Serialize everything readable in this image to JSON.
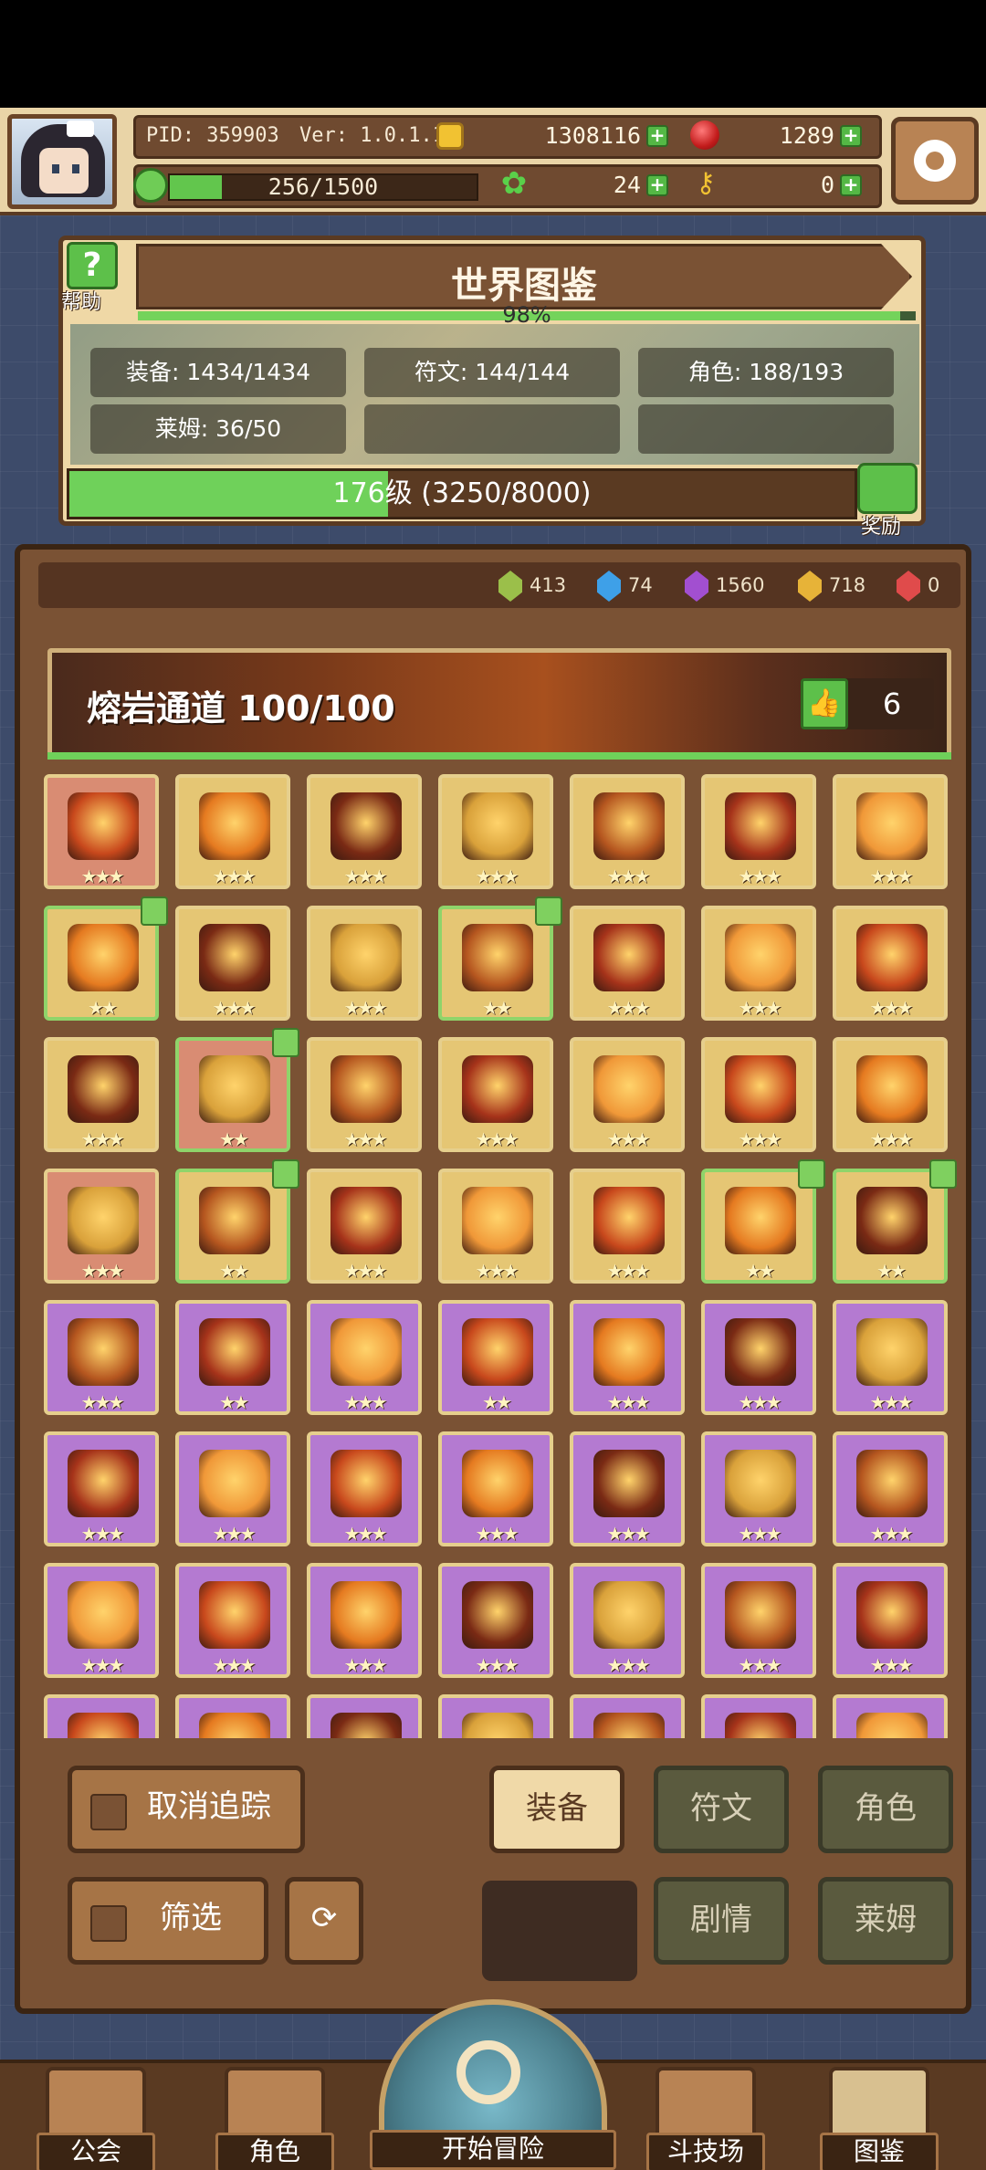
{
  "header": {
    "pid": "PID: 359903",
    "version": "Ver: 1.0.1.13",
    "gold": "1308116",
    "ruby": "1289",
    "stamina": "256/1500",
    "stamina_fraction": 0.17,
    "clover": "24",
    "key": "0"
  },
  "world": {
    "title": "世界图鉴",
    "help_label": "帮助",
    "percent": "98%",
    "percent_value": 0.98,
    "stats": [
      "装备: 1434/1434",
      "符文: 144/144",
      "角色: 188/193",
      "莱姆: 36/50"
    ],
    "level_text": "176级 (3250/8000)",
    "level_fraction": 0.406,
    "reward_label": "奖励"
  },
  "gems": [
    {
      "value": "413",
      "color": "#9bbf4a"
    },
    {
      "value": "74",
      "color": "#3ea0e8"
    },
    {
      "value": "1560",
      "color": "#a24fd0"
    },
    {
      "value": "718",
      "color": "#e7b338"
    },
    {
      "value": "0",
      "color": "#e04b4b"
    }
  ],
  "zone": {
    "title": "熔岩通道  100/100",
    "likes": "6"
  },
  "grid": {
    "rows": [
      [
        {
          "bg": "red",
          "stars": "★★★",
          "flag": false
        },
        {
          "bg": "gold",
          "stars": "★★★",
          "flag": false
        },
        {
          "bg": "gold",
          "stars": "★★★",
          "flag": false
        },
        {
          "bg": "gold",
          "stars": "★★★",
          "flag": false
        },
        {
          "bg": "gold",
          "stars": "★★★",
          "flag": false
        },
        {
          "bg": "gold",
          "stars": "★★★",
          "flag": false
        },
        {
          "bg": "gold",
          "stars": "★★★",
          "flag": false
        }
      ],
      [
        {
          "bg": "gold",
          "stars": "★★",
          "flag": true
        },
        {
          "bg": "gold",
          "stars": "★★★",
          "flag": false
        },
        {
          "bg": "gold",
          "stars": "★★★",
          "flag": false
        },
        {
          "bg": "gold",
          "stars": "★★",
          "flag": true
        },
        {
          "bg": "gold",
          "stars": "★★★",
          "flag": false
        },
        {
          "bg": "gold",
          "stars": "★★★",
          "flag": false
        },
        {
          "bg": "gold",
          "stars": "★★★",
          "flag": false
        }
      ],
      [
        {
          "bg": "gold",
          "stars": "★★★",
          "flag": false
        },
        {
          "bg": "red",
          "stars": "★★",
          "flag": true
        },
        {
          "bg": "gold",
          "stars": "★★★",
          "flag": false
        },
        {
          "bg": "gold",
          "stars": "★★★",
          "flag": false
        },
        {
          "bg": "gold",
          "stars": "★★★",
          "flag": false
        },
        {
          "bg": "gold",
          "stars": "★★★",
          "flag": false
        },
        {
          "bg": "gold",
          "stars": "★★★",
          "flag": false
        }
      ],
      [
        {
          "bg": "red",
          "stars": "★★★",
          "flag": false
        },
        {
          "bg": "gold",
          "stars": "★★",
          "flag": true
        },
        {
          "bg": "gold",
          "stars": "★★★",
          "flag": false
        },
        {
          "bg": "gold",
          "stars": "★★★",
          "flag": false
        },
        {
          "bg": "gold",
          "stars": "★★★",
          "flag": false
        },
        {
          "bg": "gold",
          "stars": "★★",
          "flag": true
        },
        {
          "bg": "gold",
          "stars": "★★",
          "flag": true
        }
      ],
      [
        {
          "bg": "purple",
          "stars": "★★★",
          "flag": false
        },
        {
          "bg": "purple",
          "stars": "★★",
          "flag": false
        },
        {
          "bg": "purple",
          "stars": "★★★",
          "flag": false
        },
        {
          "bg": "purple",
          "stars": "★★",
          "flag": false
        },
        {
          "bg": "purple",
          "stars": "★★★",
          "flag": false
        },
        {
          "bg": "purple",
          "stars": "★★★",
          "flag": false
        },
        {
          "bg": "purple",
          "stars": "★★★",
          "flag": false
        }
      ],
      [
        {
          "bg": "purple",
          "stars": "★★★",
          "flag": false
        },
        {
          "bg": "purple",
          "stars": "★★★",
          "flag": false
        },
        {
          "bg": "purple",
          "stars": "★★★",
          "flag": false
        },
        {
          "bg": "purple",
          "stars": "★★★",
          "flag": false
        },
        {
          "bg": "purple",
          "stars": "★★★",
          "flag": false
        },
        {
          "bg": "purple",
          "stars": "★★★",
          "flag": false
        },
        {
          "bg": "purple",
          "stars": "★★★",
          "flag": false
        }
      ],
      [
        {
          "bg": "purple",
          "stars": "★★★",
          "flag": false
        },
        {
          "bg": "purple",
          "stars": "★★★",
          "flag": false
        },
        {
          "bg": "purple",
          "stars": "★★★",
          "flag": false
        },
        {
          "bg": "purple",
          "stars": "★★★",
          "flag": false
        },
        {
          "bg": "purple",
          "stars": "★★★",
          "flag": false
        },
        {
          "bg": "purple",
          "stars": "★★★",
          "flag": false
        },
        {
          "bg": "purple",
          "stars": "★★★",
          "flag": false
        }
      ],
      [
        {
          "bg": "purple",
          "stars": "",
          "flag": false
        },
        {
          "bg": "purple",
          "stars": "",
          "flag": false
        },
        {
          "bg": "purple",
          "stars": "",
          "flag": false
        },
        {
          "bg": "purple",
          "stars": "",
          "flag": false
        },
        {
          "bg": "purple",
          "stars": "",
          "flag": false
        },
        {
          "bg": "purple",
          "stars": "",
          "flag": false
        },
        {
          "bg": "purple",
          "stars": "",
          "flag": false
        }
      ]
    ]
  },
  "controls": {
    "untrack": "取消追踪",
    "filter": "筛选",
    "tab_equipment": "装备",
    "tab_rune": "符文",
    "tab_character": "角色",
    "tab_story": "剧情",
    "tab_slime": "莱姆"
  },
  "nav": {
    "guild": "公会",
    "character": "角色",
    "start": "开始冒险",
    "arena": "斗技场",
    "codex": "图鉴"
  }
}
